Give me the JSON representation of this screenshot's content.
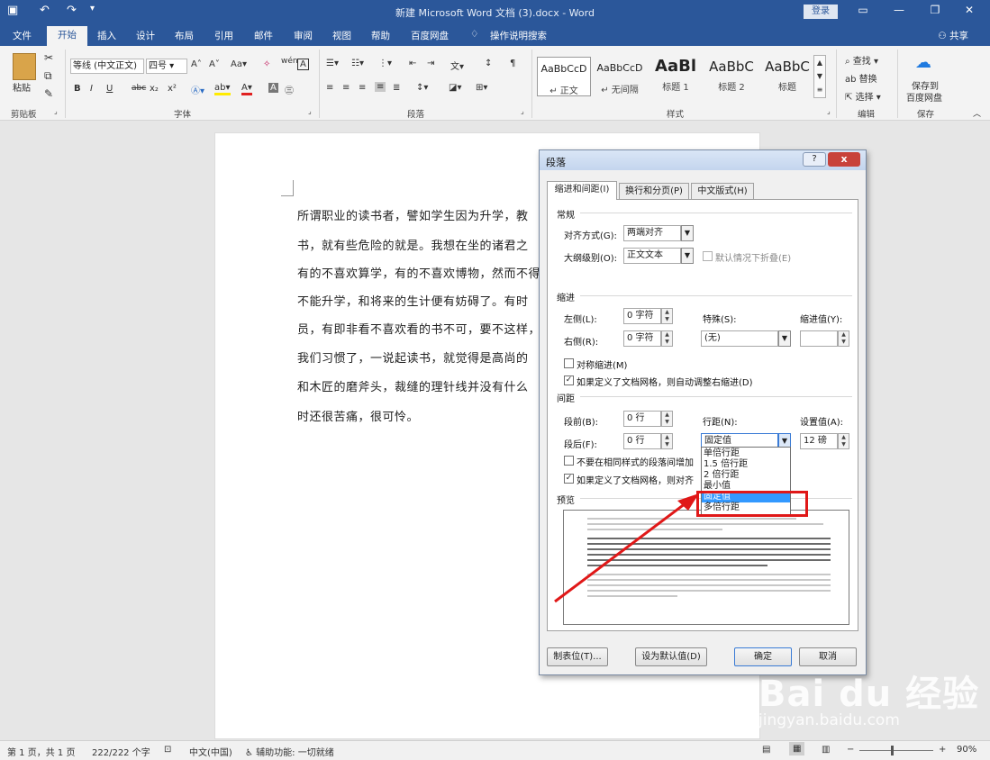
{
  "titlebar": {
    "title": "新建 Microsoft Word 文档 (3).docx  -  Word",
    "login": "登录",
    "save_icon": "save-icon",
    "undo": "↶",
    "redo": "↷",
    "customize": "▾"
  },
  "tabs": {
    "file": "文件",
    "home": "开始",
    "insert": "插入",
    "design": "设计",
    "layout": "布局",
    "references": "引用",
    "mailings": "邮件",
    "review": "审阅",
    "view": "视图",
    "help": "帮助",
    "baidu": "百度网盘",
    "tellme": "操作说明搜索",
    "share": "共享"
  },
  "ribbon": {
    "clipboard": {
      "paste": "粘贴",
      "label": "剪贴板"
    },
    "font": {
      "name": "等线 (中文正文)",
      "size": "四号",
      "label": "字体",
      "grow": "A˄",
      "shrink": "A˅",
      "case": "Aa",
      "clear": "A",
      "phonetic": "wén",
      "border": "A",
      "bold": "B",
      "italic": "I",
      "underline": "U",
      "strike": "abc",
      "sub": "x₂",
      "sup": "x²"
    },
    "paragraph": {
      "label": "段落"
    },
    "styles": {
      "label": "样式",
      "items": [
        {
          "sample": "AaBbCcD",
          "name": "↵ 正文"
        },
        {
          "sample": "AaBbCcD",
          "name": "↵ 无间隔"
        },
        {
          "sample": "AaBl",
          "name": "标题 1"
        },
        {
          "sample": "AaBbC",
          "name": "标题 2"
        },
        {
          "sample": "AaBbC",
          "name": "标题"
        }
      ]
    },
    "editing": {
      "find": "查找",
      "replace": "替换",
      "select": "选择",
      "label": "编辑"
    },
    "save": {
      "line1": "保存到",
      "line2": "百度网盘",
      "label": "保存"
    }
  },
  "document": {
    "lines": [
      "所谓职业的读书者，譬如学生因为升学，教",
      "书，就有些危险的就是。我想在坐的诸君之",
      "有的不喜欢算学，有的不喜欢博物，然而不得",
      "不能升学，和将来的生计便有妨碍了。有时",
      "员，有即非看不喜欢看的书不可，要不这样，",
      "我们习惯了，一说起读书，就觉得是高尚的",
      "和木匠的磨斧头，裁缝的理针线并没有什么",
      "时还很苦痛，很可怜。"
    ]
  },
  "dialog": {
    "title": "段落",
    "help": "?",
    "close": "x",
    "tabs": [
      "缩进和间距(I)",
      "换行和分页(P)",
      "中文版式(H)"
    ],
    "general": {
      "section": "常规",
      "align_label": "对齐方式(G):",
      "align_value": "两端对齐",
      "outline_label": "大纲级别(O):",
      "outline_value": "正文文本",
      "collapse_label": "默认情况下折叠(E)"
    },
    "indent": {
      "section": "缩进",
      "left_label": "左侧(L):",
      "left_value": "0 字符",
      "right_label": "右侧(R):",
      "right_value": "0 字符",
      "special_label": "特殊(S):",
      "special_value": "(无)",
      "by_label": "缩进值(Y):",
      "mirror_label": "对称缩进(M)",
      "auto_label": "如果定义了文档网格，则自动调整右缩进(D)"
    },
    "spacing": {
      "section": "间距",
      "before_label": "段前(B):",
      "before_value": "0 行",
      "after_label": "段后(F):",
      "after_value": "0 行",
      "line_label": "行距(N):",
      "line_value": "固定值",
      "at_label": "设置值(A):",
      "at_value": "12 磅",
      "nospace_label": "不要在相同样式的段落间增加间距(C)",
      "snap_label": "如果定义了文档网格，则对齐到网格(W)"
    },
    "preview": {
      "section": "预览"
    },
    "buttons": {
      "tabs": "制表位(T)...",
      "default": "设为默认值(D)",
      "ok": "确定",
      "cancel": "取消"
    },
    "line_options": [
      "单倍行距",
      "1.5 倍行距",
      "2 倍行距",
      "最小值",
      "固定值",
      "多倍行距"
    ],
    "line_selected": "固定值"
  },
  "statusbar": {
    "page": "第 1 页，共 1 页",
    "words": "222/222 个字",
    "lang": "中文(中国)",
    "access": "辅助功能: 一切就绪",
    "zoom": "90%"
  },
  "watermark": {
    "brand": "Bai du 经验",
    "url": "jingyan.baidu.com"
  }
}
